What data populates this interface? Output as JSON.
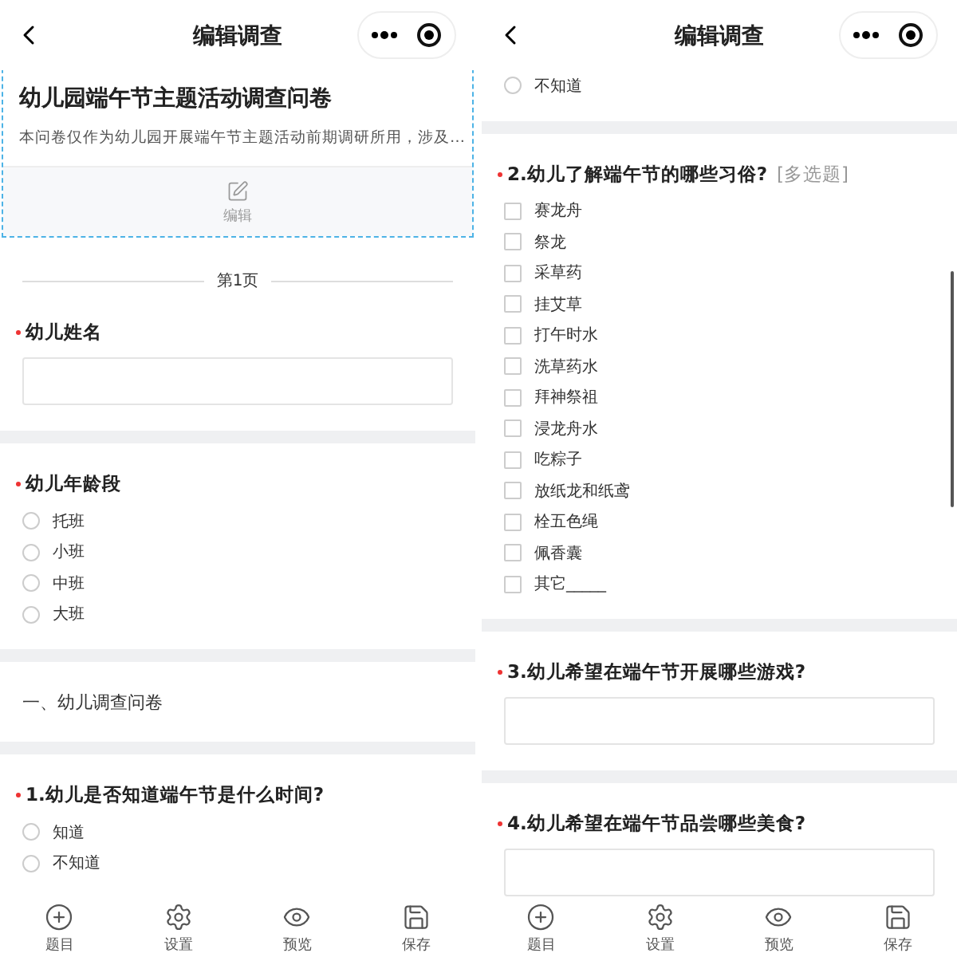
{
  "screens": [
    {
      "title": "编辑调查",
      "blocks": [
        {
          "kind": "intro",
          "selected": true,
          "title": "幼儿园端午节主题活动调查问卷",
          "description": "本问卷仅作为幼儿园开展端午节主题活动前期调研所用，涉及…",
          "edit_label": "编辑"
        },
        {
          "kind": "pager",
          "label": "第1页"
        },
        {
          "kind": "text_question",
          "required": true,
          "title": "幼儿姓名"
        },
        {
          "kind": "single_choice",
          "required": true,
          "title": "幼儿年龄段",
          "options": [
            {
              "label": "托班",
              "checked": false
            },
            {
              "label": "小班",
              "checked": false
            },
            {
              "label": "中班",
              "checked": false
            },
            {
              "label": "大班",
              "checked": false
            }
          ]
        },
        {
          "kind": "section",
          "text": "一、幼儿调查问卷"
        },
        {
          "kind": "single_choice",
          "required": true,
          "title": "1.幼儿是否知道端午节是什么时间?",
          "options": [
            {
              "label": "知道",
              "checked": false
            },
            {
              "label": "不知道",
              "checked": false
            }
          ]
        }
      ],
      "tabs": [
        {
          "label": "题目"
        },
        {
          "label": "设置"
        },
        {
          "label": "预览"
        },
        {
          "label": "保存"
        }
      ]
    },
    {
      "title": "编辑调查",
      "blocks": [
        {
          "kind": "single_choice",
          "options": [
            {
              "label": "不知道",
              "checked": false
            }
          ]
        },
        {
          "kind": "multi_choice",
          "required": true,
          "title": "2.幼儿了解端午节的哪些习俗?",
          "tag": "[多选题]",
          "options": [
            {
              "label": "赛龙舟",
              "checked": false
            },
            {
              "label": "祭龙",
              "checked": false
            },
            {
              "label": "采草药",
              "checked": false
            },
            {
              "label": "挂艾草",
              "checked": false
            },
            {
              "label": "打午时水",
              "checked": false
            },
            {
              "label": "洗草药水",
              "checked": false
            },
            {
              "label": "拜神祭祖",
              "checked": false
            },
            {
              "label": "浸龙舟水",
              "checked": false
            },
            {
              "label": "吃粽子",
              "checked": false
            },
            {
              "label": "放纸龙和纸鸢",
              "checked": false
            },
            {
              "label": "栓五色绳",
              "checked": false
            },
            {
              "label": "佩香囊",
              "checked": false
            },
            {
              "label": "其它_____",
              "checked": false
            }
          ]
        },
        {
          "kind": "text_question",
          "required": true,
          "title": "3.幼儿希望在端午节开展哪些游戏?"
        },
        {
          "kind": "text_question",
          "required": true,
          "title": "4.幼儿希望在端午节品尝哪些美食?"
        }
      ],
      "tabs": [
        {
          "label": "题目"
        },
        {
          "label": "设置"
        },
        {
          "label": "预览"
        },
        {
          "label": "保存"
        }
      ]
    }
  ]
}
